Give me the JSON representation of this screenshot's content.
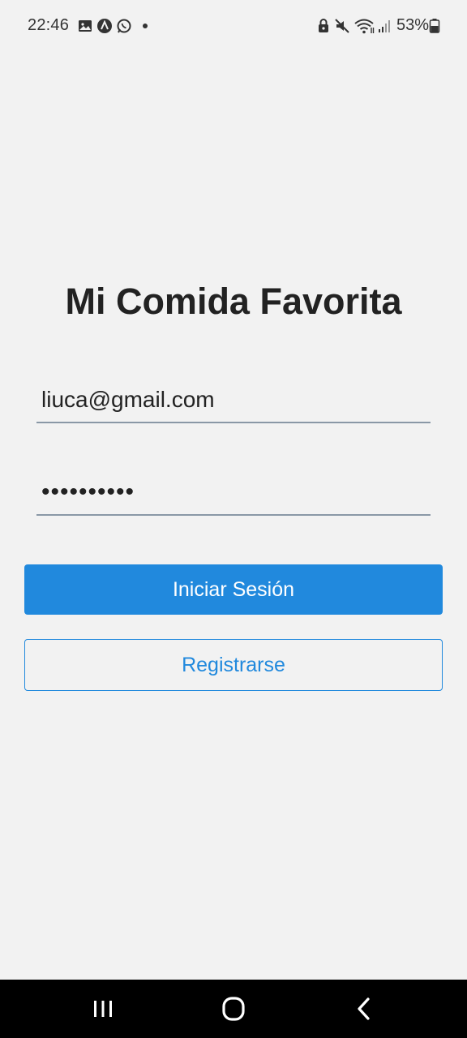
{
  "status_bar": {
    "time": "22:46",
    "battery": "53%",
    "left_icons": [
      "gallery-icon",
      "a-notification-icon",
      "whatsapp-icon",
      "dot-icon"
    ],
    "right_icons": [
      "vpn-lock-icon",
      "mute-icon",
      "wifi-icon",
      "signal-icon",
      "battery-icon"
    ]
  },
  "login": {
    "title": "Mi Comida Favorita",
    "email_value": "liuca@gmail.com",
    "password_value": "••••••••••",
    "login_button": "Iniciar Sesión",
    "register_button": "Registrarse"
  },
  "colors": {
    "background": "#f2f2f2",
    "accent": "#2189dd",
    "text": "#222222"
  },
  "nav_bar": {
    "buttons": [
      "recents-icon",
      "home-icon",
      "back-icon"
    ]
  }
}
